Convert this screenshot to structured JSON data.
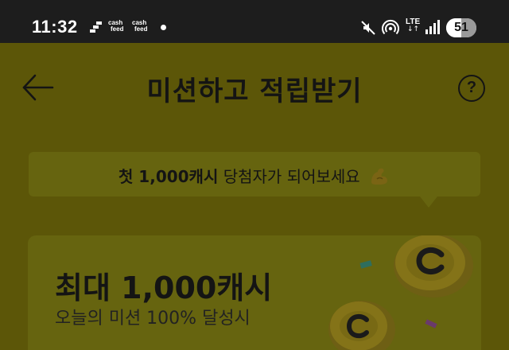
{
  "status_bar": {
    "time": "11:32",
    "notifications": [
      {
        "line1": "cash",
        "line2": "feed"
      },
      {
        "line1": "cash",
        "line2": "feed"
      }
    ],
    "network": "LTE",
    "network_arrows": "↓↑",
    "battery_level": 51,
    "battery_label": "51"
  },
  "header": {
    "title": "미션하고 적립받기",
    "help_label": "?"
  },
  "promo_bubble": {
    "highlight": "첫 1,000캐시",
    "text": " 당첨자가 되어보세요"
  },
  "reward_card": {
    "title": "최대 1,000캐시",
    "subtitle": "오늘의 미션 100% 달성시"
  },
  "colors": {
    "background": "#5c5608",
    "card": "#66640f",
    "status_bar": "#1d1d1d",
    "coin": "#7a6a18"
  },
  "icons": [
    "back-arrow-icon",
    "help-icon",
    "mute-icon",
    "hotspot-icon",
    "signal-icon",
    "muscle-icon",
    "coin-icon"
  ]
}
